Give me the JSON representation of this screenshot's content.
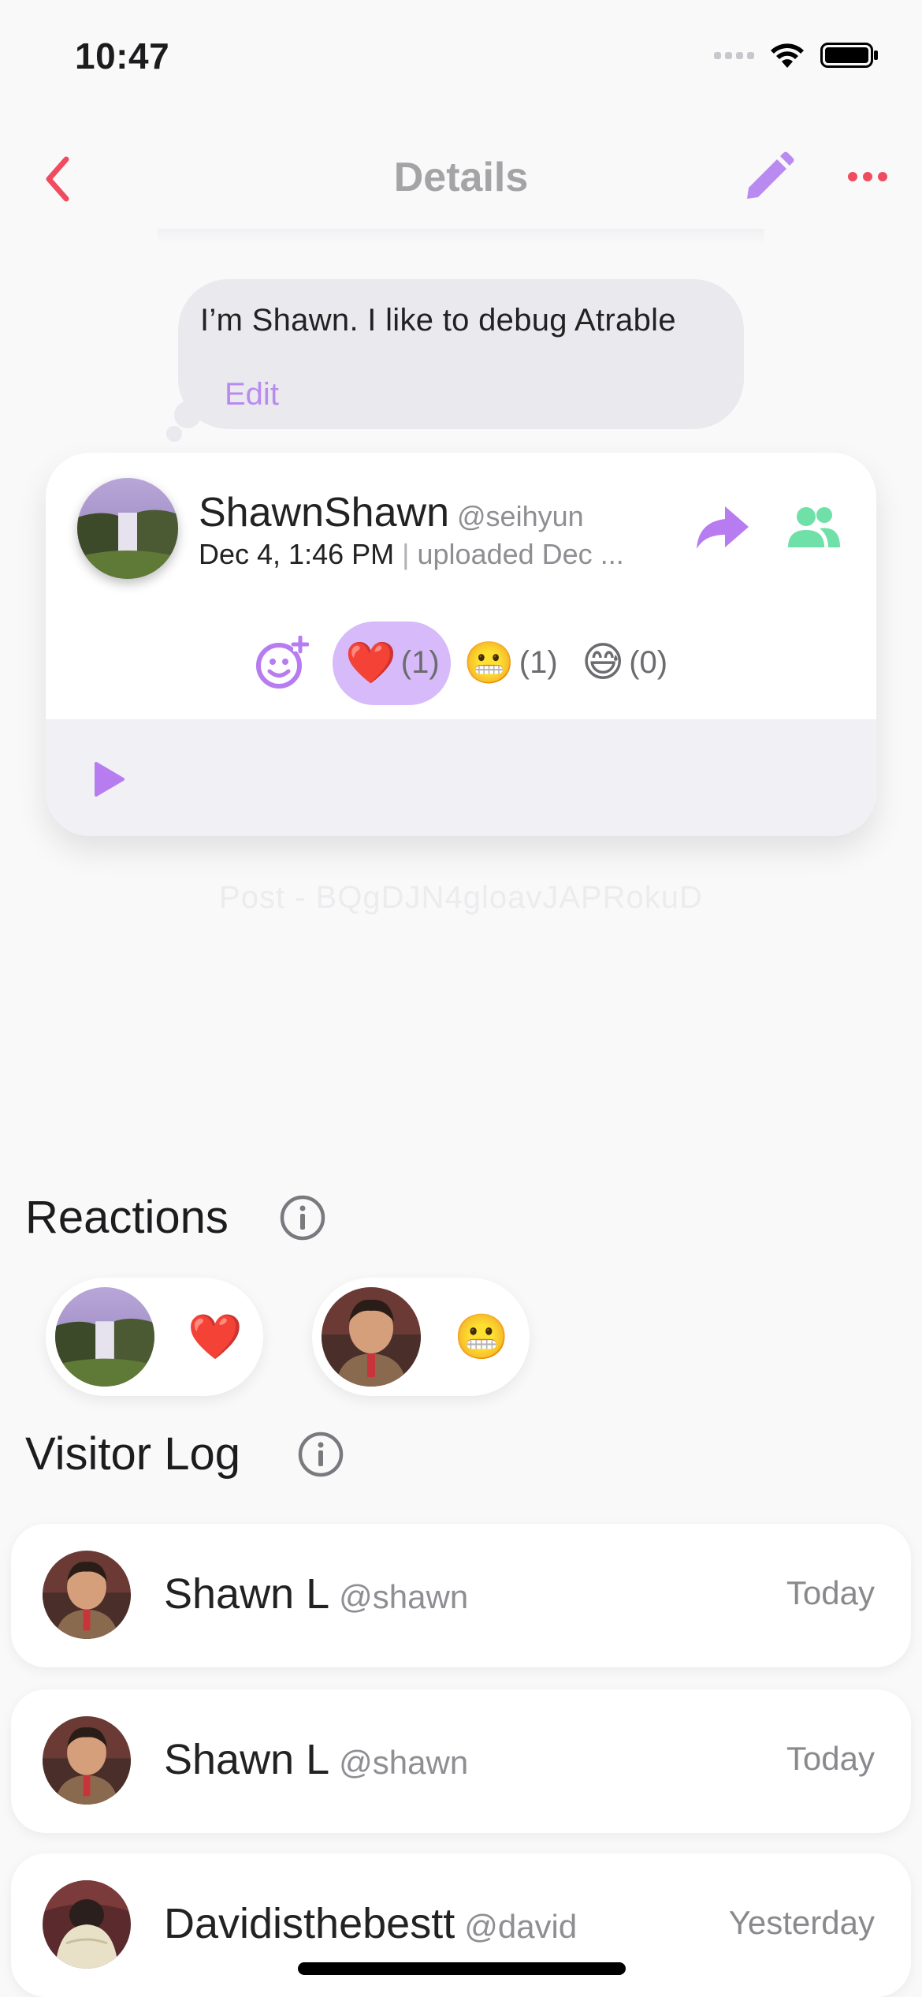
{
  "status_bar": {
    "time": "10:47"
  },
  "nav": {
    "title": "Details"
  },
  "bubble": {
    "text": "I’m Shawn. I like to debug Atrable",
    "edit_label": "Edit"
  },
  "post": {
    "name": "ShawnShawn",
    "handle": "@seihyun",
    "date": "Dec 4, 1:46 PM",
    "separator": "|",
    "uploaded": "uploaded Dec ...",
    "reactions": [
      {
        "emoji": "❤️",
        "count": "(1)",
        "selected": true
      },
      {
        "emoji": "😬",
        "count": "(1)",
        "selected": false
      },
      {
        "emoji": "😅",
        "count": "(0)",
        "selected": false
      }
    ],
    "post_id": "Post - BQgDJN4gloavJAPRokuD"
  },
  "reactions_section": {
    "title": "Reactions",
    "reactors": [
      {
        "emoji": "❤️"
      },
      {
        "emoji": "😬"
      }
    ]
  },
  "visitor_log": {
    "title": "Visitor Log",
    "rows": [
      {
        "name": "Shawn L",
        "handle": "@shawn",
        "time": "Today"
      },
      {
        "name": "Shawn L",
        "handle": "@shawn",
        "time": "Today"
      },
      {
        "name": "Davidisthebestt",
        "handle": "@david",
        "time": "Yesterday"
      }
    ]
  },
  "colors": {
    "accent_purple": "#b98bf0",
    "accent_red": "#ef4c5f",
    "accent_green": "#6fe0a8",
    "selected_pill": "#d6baf9"
  }
}
